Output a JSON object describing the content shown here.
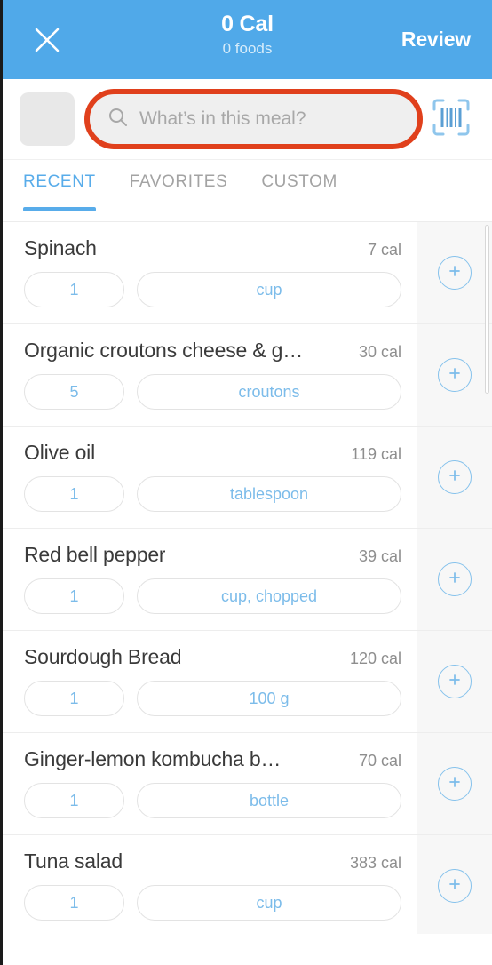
{
  "colors": {
    "header_blue": "#50A9E9",
    "accent_blue": "#58ACEA",
    "pill_blue": "#7CBCEA",
    "annotation_red": "#E0401C",
    "row_gray": "#F7F7F7"
  },
  "header": {
    "close_icon": "close-icon",
    "calories": "0 Cal",
    "foods_count": "0 foods",
    "review_label": "Review"
  },
  "search": {
    "thumbnail": "meal-photo-placeholder",
    "search_icon": "search-icon",
    "value": "",
    "placeholder": "What’s in this meal?",
    "barcode_icon": "barcode-scan-icon",
    "annotation": "red-highlight-ring"
  },
  "tabs": [
    {
      "label": "RECENT",
      "active": true
    },
    {
      "label": "FAVORITES",
      "active": false
    },
    {
      "label": "CUSTOM",
      "active": false
    }
  ],
  "foods": [
    {
      "name": "Spinach",
      "calories": "7 cal",
      "quantity": "1",
      "unit": "cup",
      "add_icon": "plus-icon"
    },
    {
      "name": "Organic croutons cheese & g…",
      "calories": "30 cal",
      "quantity": "5",
      "unit": "croutons",
      "add_icon": "plus-icon"
    },
    {
      "name": "Olive oil",
      "calories": "119 cal",
      "quantity": "1",
      "unit": "tablespoon",
      "add_icon": "plus-icon"
    },
    {
      "name": "Red bell pepper",
      "calories": "39 cal",
      "quantity": "1",
      "unit": "cup, chopped",
      "add_icon": "plus-icon"
    },
    {
      "name": "Sourdough Bread",
      "calories": "120 cal",
      "quantity": "1",
      "unit": "100 g",
      "add_icon": "plus-icon"
    },
    {
      "name": "Ginger-lemon kombucha b…",
      "calories": "70 cal",
      "quantity": "1",
      "unit": "bottle",
      "add_icon": "plus-icon"
    },
    {
      "name": "Tuna salad",
      "calories": "383 cal",
      "quantity": "1",
      "unit": "cup",
      "add_icon": "plus-icon"
    }
  ],
  "scrollbar": {
    "name": "list-scrollbar"
  }
}
